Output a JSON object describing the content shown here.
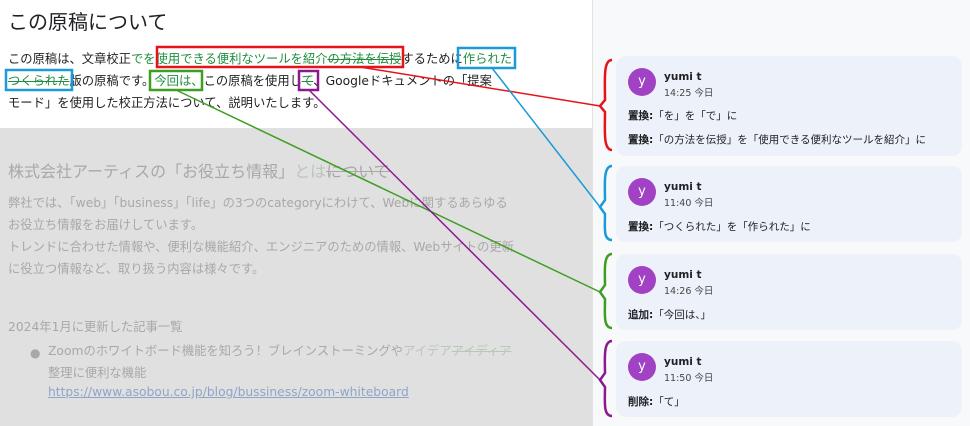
{
  "doc": {
    "title": "この原稿について",
    "line1": {
      "a": "この原稿は、文章校正",
      "b": "で",
      "c": "を使用できる便利なツールを紹介",
      "d": "の方法を伝授",
      "e": "するために",
      "f": "作られた"
    },
    "line2": {
      "a": "つくられた",
      "b": "版の原稿です。",
      "c": "今回は、",
      "d": "この原稿を使用し",
      "e": "て",
      "f": "、Googleドキュメントの「提案"
    },
    "line3": "モード」を使用した校正方法について、説明いたします。",
    "faded": {
      "heading_a": "株式会社アーティスの「お役立ち情報」",
      "heading_b": "とは",
      "heading_c": "について",
      "p1": "弊社では、「web」「business」「life」の3つのcategoryにわけて、Webに関するあらゆる",
      "p2": "お役立ち情報をお届けしています。",
      "p3": "トレンドに合わせた情報や、便利な機能紹介、エンジニアのための情報、Webサイトの更新",
      "p4": "に役立つ情報など、取り扱う内容は様々です。",
      "update": "2024年1月に更新した記事一覧",
      "item_a": "Zoomのホワイトボード機能を知ろう！ブレインストーミングや",
      "item_b": "アイデア",
      "item_c": "アイディア",
      "item_d": "整理に便利な機能",
      "link": "https://www.asobou.co.jp/blog/bussiness/zoom-whiteboard"
    }
  },
  "comments": [
    {
      "avatar": "y",
      "name": "yumi t",
      "time": "14:25 今日",
      "actions": [
        {
          "label": "置換:",
          "text": "「を」を「で」に"
        },
        {
          "label": "置換:",
          "text": "「の方法を伝授」を「使用できる便利なツールを紹介」に"
        }
      ],
      "color": "#e5141b"
    },
    {
      "avatar": "y",
      "name": "yumi t",
      "time": "11:40 今日",
      "actions": [
        {
          "label": "置換:",
          "text": "「つくられた」を「作られた」に"
        }
      ],
      "color": "#1a9bd7"
    },
    {
      "avatar": "y",
      "name": "yumi t",
      "time": "14:26 今日",
      "actions": [
        {
          "label": "追加:",
          "text": "「今回は、」"
        }
      ],
      "color": "#3d9f22"
    },
    {
      "avatar": "y",
      "name": "yumi t",
      "time": "11:50 今日",
      "actions": [
        {
          "label": "削除:",
          "text": "「て」"
        }
      ],
      "color": "#8b1a8e"
    }
  ]
}
